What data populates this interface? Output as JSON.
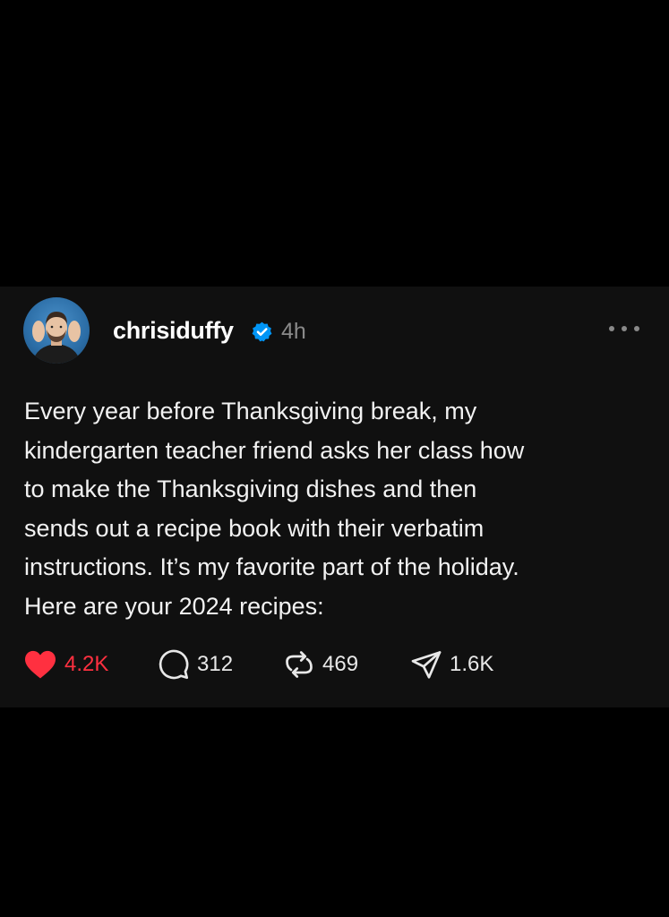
{
  "post": {
    "username": "chrisiduffy",
    "time": "4h",
    "body_lines": [
      "Every year before Thanksgiving break, my",
      "kindergarten teacher friend asks her class how",
      "to make the Thanksgiving dishes and then",
      "sends out a recipe book with their verbatim",
      "instructions. It’s my favorite part of the holiday.",
      "Here are your 2024 recipes:"
    ],
    "actions": {
      "likes": "4.2K",
      "replies": "312",
      "reposts": "469",
      "shares": "1.6K"
    }
  },
  "colors": {
    "background": "#000000",
    "card": "#101010",
    "like": "#ff3040",
    "verified": "#0095f6",
    "muted": "#8a8a8a"
  },
  "icons": {
    "verified": "verified-badge-icon",
    "more": "more-options-icon",
    "like": "heart-icon",
    "reply": "comment-icon",
    "repost": "repost-icon",
    "share": "share-icon"
  }
}
